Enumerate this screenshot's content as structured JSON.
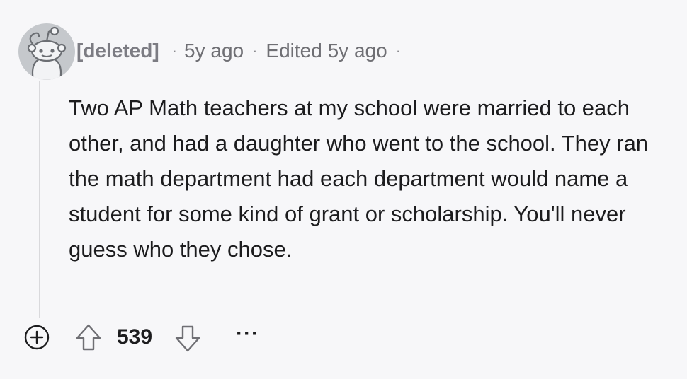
{
  "comment": {
    "author": "[deleted]",
    "separator": "·",
    "time": "5y ago",
    "edited": "Edited 5y ago",
    "body": "Two AP Math teachers at my school were married to each other, and had a daughter who went to the school. They ran the math department had each department would name a student for some kind of grant or scholarship. You'll never guess who they chose.",
    "score": "539",
    "more": "···"
  },
  "icons": {
    "avatar": "snoo-avatar-icon",
    "expand": "plus-circle-icon",
    "upvote": "upvote-arrow-icon",
    "downvote": "downvote-arrow-icon",
    "more": "ellipsis-icon"
  },
  "colors": {
    "background": "#f7f7f9",
    "text": "#1c1c1e",
    "muted": "#6f6f74",
    "thread_line": "#d9d9dc"
  }
}
